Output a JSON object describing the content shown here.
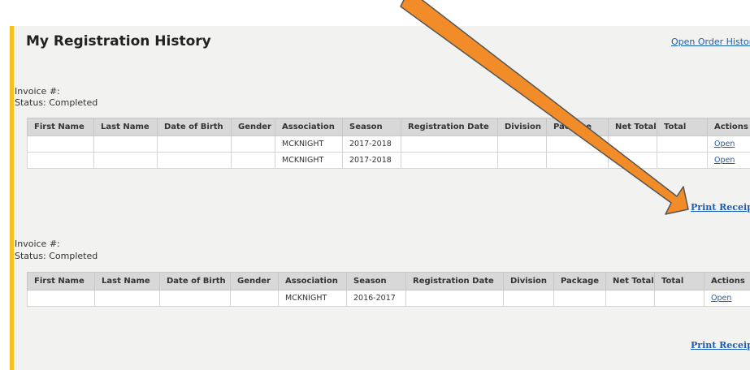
{
  "header": {
    "title": "My Registration History",
    "order_history_link": "Open Order History"
  },
  "columns": [
    "First Name",
    "Last Name",
    "Date of Birth",
    "Gender",
    "Association",
    "Season",
    "Registration Date",
    "Division",
    "Package",
    "Net Total",
    "Total",
    "Actions"
  ],
  "invoices": [
    {
      "invoice_label": "Invoice #:",
      "status_label": "Status: Completed",
      "rows": [
        [
          "",
          "",
          "",
          "",
          "MCKNIGHT",
          "2017-2018",
          "",
          "",
          "",
          "",
          "",
          "Open"
        ],
        [
          "",
          "",
          "",
          "",
          "MCKNIGHT",
          "2017-2018",
          "",
          "",
          "",
          "",
          "",
          "Open"
        ]
      ],
      "print_label": "Print Receipt"
    },
    {
      "invoice_label": "Invoice #:",
      "status_label": "Status: Completed",
      "rows": [
        [
          "",
          "",
          "",
          "",
          "MCKNIGHT",
          "2016-2017",
          "",
          "",
          "",
          "",
          "",
          "Open"
        ]
      ],
      "print_label": "Print Receipt"
    }
  ],
  "annotation": {
    "arrow_color": "#f28c28",
    "arrow_outline": "#555555"
  },
  "colors": {
    "accent": "#f5c21b",
    "link": "#1a5fb4",
    "panel": "#f2f2f0",
    "header_row": "#d8d8d8"
  }
}
